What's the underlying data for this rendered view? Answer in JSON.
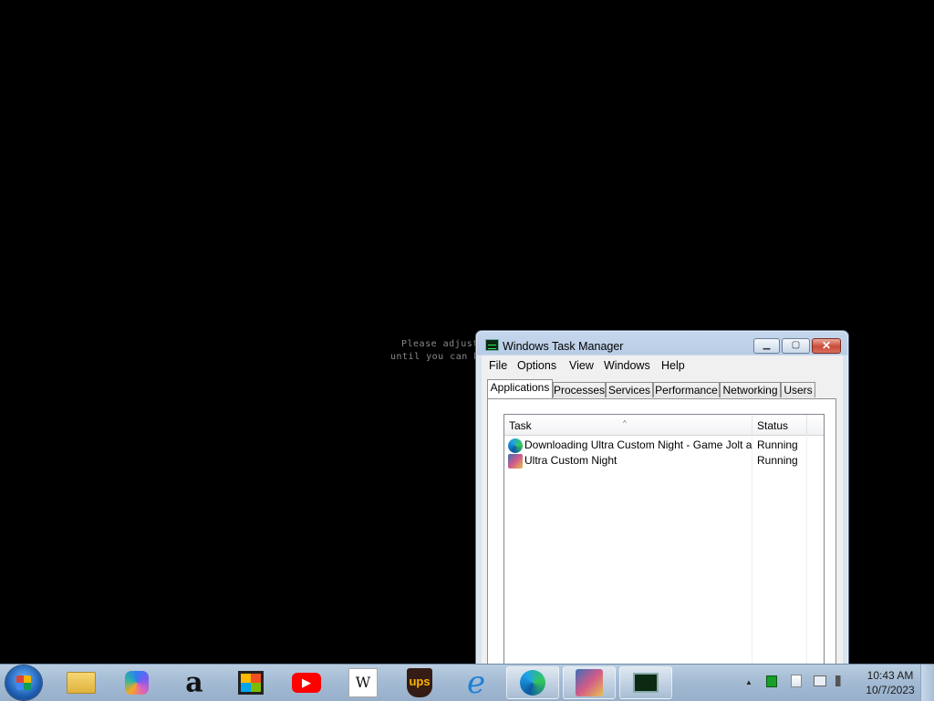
{
  "desktop": {
    "hint_line1": "Please adjust",
    "hint_line2": "until you can he"
  },
  "window": {
    "title": "Windows Task Manager",
    "minimize_glyph": "▁",
    "maximize_glyph": "▢",
    "close_glyph": "✕"
  },
  "menu": {
    "items": [
      "File",
      "Options",
      "View",
      "Windows",
      "Help"
    ]
  },
  "tabs": [
    "Applications",
    "Processes",
    "Services",
    "Performance",
    "Networking",
    "Users"
  ],
  "active_tab": "Applications",
  "listview": {
    "columns": [
      "Task",
      "Status"
    ],
    "sort_indicator": "^",
    "rows": [
      {
        "task": "Downloading Ultra Custom Night - Game Jolt and...",
        "status": "Running",
        "icon": "edge-icon"
      },
      {
        "task": "Ultra Custom Night",
        "status": "Running",
        "icon": "ucn-game-icon"
      }
    ]
  },
  "taskbar": {
    "pinned": [
      {
        "name": "file-explorer-icon",
        "open": false
      },
      {
        "name": "copilot-icon",
        "open": false
      },
      {
        "name": "amazon-icon",
        "open": false,
        "glyph": "a"
      },
      {
        "name": "microsoft-store-icon",
        "open": false
      },
      {
        "name": "youtube-icon",
        "open": false,
        "glyph": "▶"
      },
      {
        "name": "wikipedia-icon",
        "open": false,
        "glyph": "W"
      },
      {
        "name": "ups-icon",
        "open": false,
        "glyph": "ups"
      },
      {
        "name": "internet-explorer-icon",
        "open": false,
        "glyph": "e"
      },
      {
        "name": "edge-icon",
        "open": true
      },
      {
        "name": "ucn-game-icon",
        "open": true
      },
      {
        "name": "task-manager-icon",
        "open": true
      }
    ],
    "tray": {
      "show_hidden_glyph": "▲",
      "time": "10:43 AM",
      "date": "10/7/2023"
    }
  },
  "colors": {
    "accent_blue": "#1d5fb3",
    "close_red": "#c94a38",
    "youtube_red": "#ff0000",
    "ups_brown": "#351c15",
    "ups_gold": "#ffb500"
  }
}
